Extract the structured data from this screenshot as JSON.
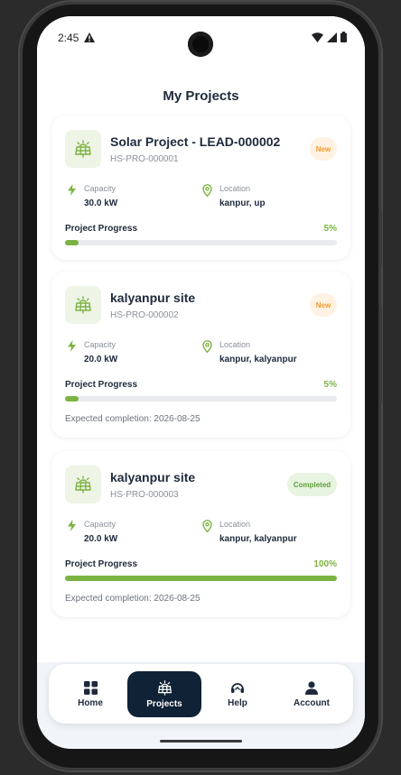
{
  "status_bar": {
    "time": "2:45"
  },
  "page": {
    "title": "My Projects"
  },
  "labels": {
    "capacity": "Capacity",
    "location": "Location",
    "project_progress": "Project Progress"
  },
  "projects": [
    {
      "name": "Solar Project - LEAD-000002",
      "code": "HS-PRO-000001",
      "status": "New",
      "capacity": "30.0 kW",
      "location": "kanpur, up",
      "progress_text": "5%",
      "progress": 0.05,
      "expected": null
    },
    {
      "name": "kalyanpur site",
      "code": "HS-PRO-000002",
      "status": "New",
      "capacity": "20.0 kW",
      "location": "kanpur, kalyanpur",
      "progress_text": "5%",
      "progress": 0.05,
      "expected": "Expected completion: 2026-08-25"
    },
    {
      "name": "kalyanpur site",
      "code": "HS-PRO-000003",
      "status": "Completed",
      "capacity": "20.0 kW",
      "location": "kanpur, kalyanpur",
      "progress_text": "100%",
      "progress": 1.0,
      "expected": "Expected completion: 2026-08-25"
    }
  ],
  "nav": {
    "items": [
      {
        "label": "Home",
        "icon": "grid-icon",
        "active": false
      },
      {
        "label": "Projects",
        "icon": "solar-panel-icon",
        "active": true
      },
      {
        "label": "Help",
        "icon": "headset-icon",
        "active": false
      },
      {
        "label": "Account",
        "icon": "person-icon",
        "active": false
      }
    ]
  },
  "colors": {
    "accent": "#7cb342",
    "nav_active": "#0f2236",
    "badge_new_text": "#f29a2e",
    "badge_completed_text": "#5da039"
  }
}
